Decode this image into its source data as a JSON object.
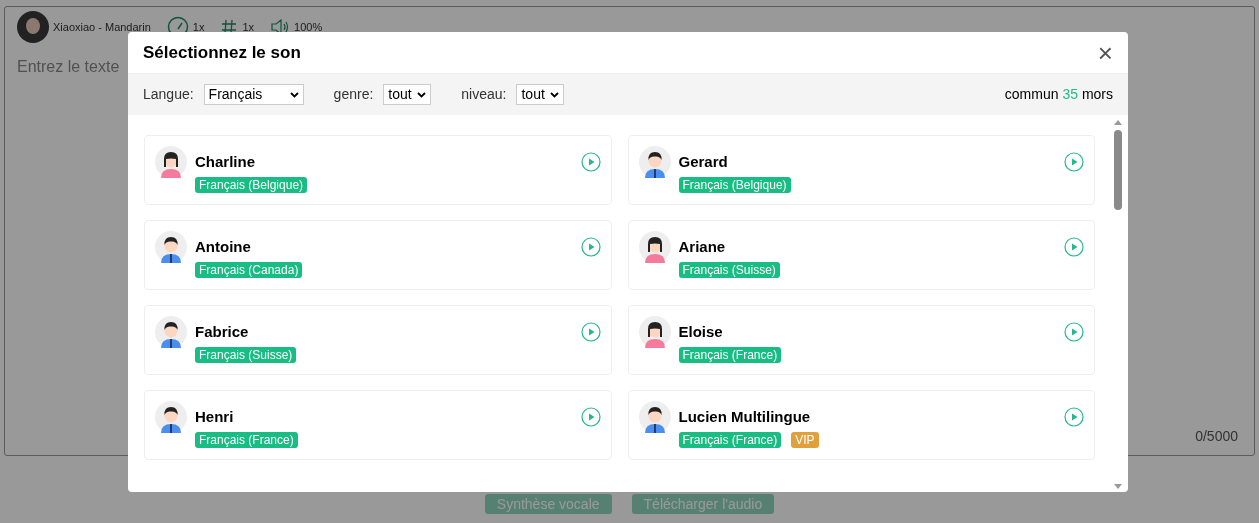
{
  "editor": {
    "voice": "Xiaoxiao - Mandarin",
    "speed": "1x",
    "pitch": "1x",
    "volume": "100%",
    "placeholder": "Entrez le texte",
    "counter": "0/5000"
  },
  "actions": [
    "Synthèse vocale",
    "Télécharger l'audio"
  ],
  "dialog": {
    "title": "Sélectionnez le son",
    "close": "×",
    "filters": [
      {
        "label": "Langue:",
        "value": "Français"
      },
      {
        "label": "genre:",
        "value": "tout"
      },
      {
        "label": "niveau:",
        "value": "tout"
      }
    ],
    "count": {
      "before": "commun",
      "number": "35",
      "after": "mors"
    },
    "voices": [
      {
        "name": "Charline",
        "kind": "female",
        "tags": [
          {
            "kind": "lang",
            "text": "Français (Belgique)"
          }
        ]
      },
      {
        "name": "Gerard",
        "kind": "male",
        "tags": [
          {
            "kind": "lang",
            "text": "Français (Belgique)"
          }
        ]
      },
      {
        "name": "Antoine",
        "kind": "male",
        "tags": [
          {
            "kind": "lang",
            "text": "Français (Canada)"
          }
        ]
      },
      {
        "name": "Ariane",
        "kind": "female",
        "tags": [
          {
            "kind": "lang",
            "text": "Français (Suisse)"
          }
        ]
      },
      {
        "name": "Fabrice",
        "kind": "male",
        "tags": [
          {
            "kind": "lang",
            "text": "Français (Suisse)"
          }
        ]
      },
      {
        "name": "Eloise",
        "kind": "female",
        "tags": [
          {
            "kind": "lang",
            "text": "Français (France)"
          }
        ]
      },
      {
        "name": "Henri",
        "kind": "male",
        "tags": [
          {
            "kind": "lang",
            "text": "Français (France)"
          }
        ]
      },
      {
        "name": "Lucien Multilingue",
        "kind": "male",
        "tags": [
          {
            "kind": "lang",
            "text": "Français (France)"
          },
          {
            "kind": "vip",
            "text": "VIP"
          }
        ]
      }
    ]
  }
}
